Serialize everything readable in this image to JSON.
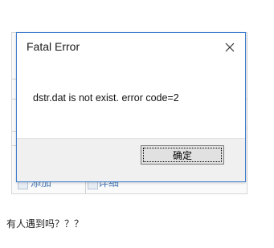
{
  "dialog": {
    "title": "Fatal Error",
    "message": "dstr.dat is not exist. error code=2",
    "ok_label": "确定",
    "close_icon": "close-icon"
  },
  "background": {
    "toolbar_item_1": "添加",
    "toolbar_item_2": "详细"
  },
  "post": {
    "text": "有人遇到吗？？？"
  }
}
